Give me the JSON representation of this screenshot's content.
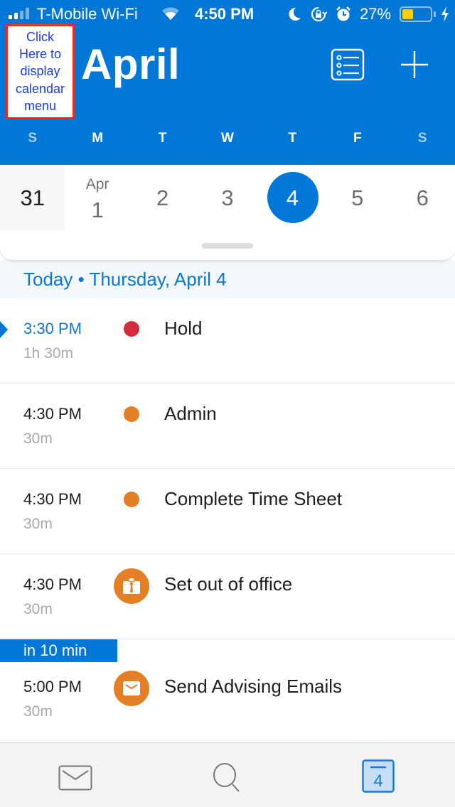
{
  "status_bar": {
    "carrier": "T-Mobile Wi-Fi",
    "time": "4:50 PM",
    "battery_percent_label": "27%",
    "battery_level": 0.27,
    "battery_color": "#ffcc00",
    "signal_bars_active": 2,
    "signal_bars_total": 4,
    "icons": [
      "wifi-icon",
      "moon-icon",
      "rotation-lock-icon",
      "alarm-icon",
      "battery-icon",
      "charging-bolt-icon"
    ]
  },
  "header": {
    "menu_callout": [
      "Click",
      "Here to",
      "display",
      "calendar",
      "menu"
    ],
    "month": "April",
    "agenda_view_icon": "list-view-icon",
    "add_icon": "plus-icon",
    "accent_color": "#0177d7"
  },
  "weekdays": [
    "S",
    "M",
    "T",
    "W",
    "T",
    "F",
    "S"
  ],
  "week_days": [
    {
      "num": "31",
      "month": "",
      "state": "past"
    },
    {
      "num": "1",
      "month": "Apr",
      "state": "normal"
    },
    {
      "num": "2",
      "month": "",
      "state": "normal"
    },
    {
      "num": "3",
      "month": "",
      "state": "normal"
    },
    {
      "num": "4",
      "month": "",
      "state": "selected"
    },
    {
      "num": "5",
      "month": "",
      "state": "normal"
    },
    {
      "num": "6",
      "month": "",
      "state": "normal"
    }
  ],
  "agenda": {
    "date_header": "Today • Thursday, April 4",
    "events": [
      {
        "time": "3:30 PM",
        "duration": "1h 30m",
        "title": "Hold",
        "marker": "dot",
        "color": "#d42c3a",
        "current": true
      },
      {
        "time": "4:30 PM",
        "duration": "30m",
        "title": "Admin",
        "marker": "dot",
        "color": "#e57f25",
        "current": false
      },
      {
        "time": "4:30 PM",
        "duration": "30m",
        "title": "Complete Time Sheet",
        "marker": "dot",
        "color": "#e57f25",
        "current": false
      },
      {
        "time": "4:30 PM",
        "duration": "30m",
        "title": "Set out of office",
        "marker": "out-of-office-icon",
        "color": "#e57f25",
        "current": false
      },
      {
        "time": "5:00 PM",
        "duration": "30m",
        "title": "Send Advising Emails",
        "marker": "mail-icon",
        "color": "#e57f25",
        "current": false,
        "badge": "in 10 min"
      }
    ]
  },
  "tab_bar": {
    "tabs": [
      {
        "name": "mail",
        "icon": "mail-icon",
        "active": false
      },
      {
        "name": "search",
        "icon": "search-icon",
        "active": false
      },
      {
        "name": "calendar",
        "icon": "calendar-icon",
        "active": true,
        "label": "4"
      }
    ]
  }
}
